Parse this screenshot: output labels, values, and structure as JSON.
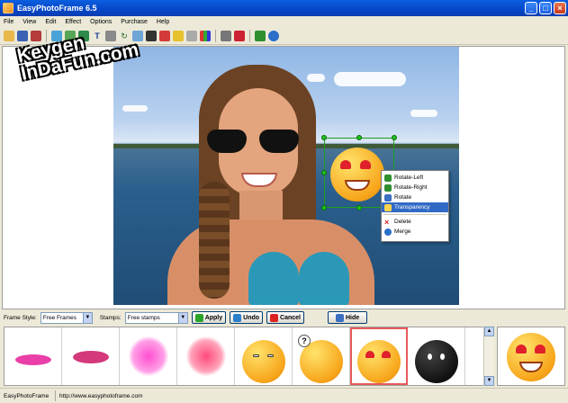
{
  "window": {
    "title": "EasyPhotoFrame 6.5"
  },
  "menu": [
    "File",
    "View",
    "Edit",
    "Effect",
    "Options",
    "Purchase",
    "Help"
  ],
  "watermark": {
    "line1": "Keygen",
    "line2": "InDaFun.com"
  },
  "context_menu": {
    "items": [
      "Rotate-Left",
      "Rotate-Right",
      "Rotate",
      "Transparency"
    ],
    "items2": [
      "Delete",
      "Merge"
    ],
    "active": "Transparency"
  },
  "controls": {
    "frame_style_label": "Frame Style:",
    "frame_style_value": "Free Frames",
    "stamps_label": "Stamps:",
    "stamps_value": "Free stamps",
    "apply": "Apply",
    "undo": "Undo",
    "cancel": "Cancel",
    "hide": "Hide"
  },
  "status": {
    "app": "EasyPhotoFrame",
    "url": "http://www.easyphotoframe.com"
  },
  "colors": {
    "titlebar": "#0546C7",
    "menu_highlight": "#316AC5",
    "selection_green": "#1FC01F"
  }
}
